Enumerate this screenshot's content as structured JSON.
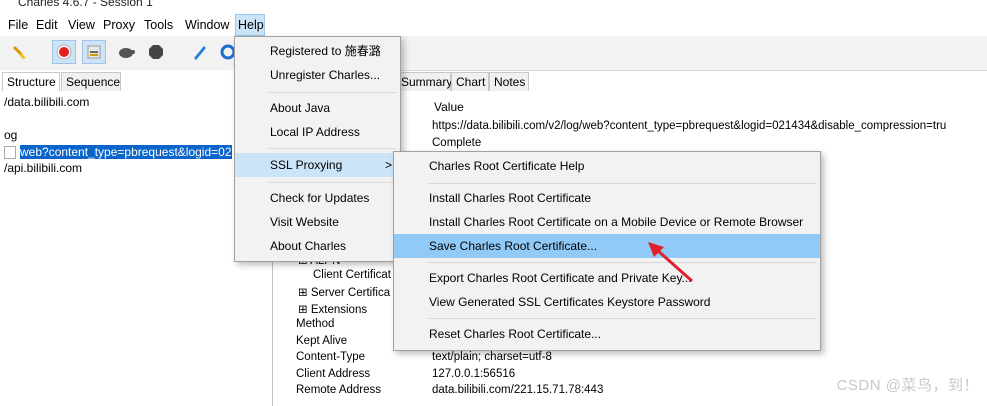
{
  "window": {
    "title": "Charles 4.6.7 - Session 1"
  },
  "menubar": {
    "items": [
      "File",
      "Edit",
      "View",
      "Proxy",
      "Tools",
      "Window",
      "Help"
    ]
  },
  "toolbar": {
    "icons": [
      "broom-icon",
      "record-icon",
      "throttle-icon",
      "turtle-icon",
      "hexagon-stop-icon",
      "pen-icon",
      "refresh-icon"
    ]
  },
  "left": {
    "tabs": [
      "Structure",
      "Sequence"
    ],
    "tree": [
      "/data.bilibili.com",
      "og",
      "web?content_type=pbrequest&logid=02",
      "/api.bilibili.com"
    ]
  },
  "right": {
    "tabs": [
      "Summary",
      "Chart",
      "Notes"
    ],
    "value_header": "Value",
    "url_value": "https://data.bilibili.com/v2/log/web?content_type=pbrequest&logid=021434&disable_compression=tru",
    "status_value": "Complete",
    "tree_rows": [
      "ALPN",
      "Client Certificat",
      "Server Certifica",
      "Extensions"
    ],
    "props": [
      {
        "name": "Method",
        "value": ""
      },
      {
        "name": "Kept Alive",
        "value": ""
      },
      {
        "name": "Content-Type",
        "value": "text/plain; charset=utf-8"
      },
      {
        "name": "Client Address",
        "value": "127.0.0.1:56516"
      },
      {
        "name": "Remote Address",
        "value": "data.bilibili.com/221.15.71.78:443"
      }
    ]
  },
  "help_menu": {
    "items": [
      "Registered to 施春潞",
      "Unregister Charles...",
      "About Java",
      "Local IP Address",
      "SSL Proxying",
      "Check for Updates",
      "Visit Website",
      "About Charles"
    ],
    "submenu_arrow": ">"
  },
  "ssl_submenu": {
    "items": [
      "Charles Root Certificate Help",
      "Install Charles Root Certificate",
      "Install Charles Root Certificate on a Mobile Device or Remote Browser",
      "Save Charles Root Certificate...",
      "Export Charles Root Certificate and Private Key...",
      "View Generated SSL Certificates Keystore Password",
      "Reset Charles Root Certificate..."
    ]
  },
  "watermark": "CSDN @菜鸟，到！",
  "colors": {
    "selection": "#0a64c9",
    "menu_highlight": "#91c9f7",
    "arrow": "#e0202a"
  }
}
